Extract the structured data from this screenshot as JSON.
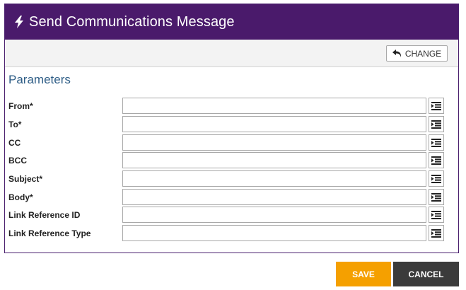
{
  "dialog": {
    "title": "Send Communications Message",
    "title_icon": "lightning-bolt-icon"
  },
  "toolbar": {
    "change_label": "CHANGE",
    "change_icon": "undo-arrow-icon"
  },
  "parameters": {
    "heading": "Parameters",
    "fields": [
      {
        "label": "From*",
        "value": ""
      },
      {
        "label": "To*",
        "value": ""
      },
      {
        "label": "CC",
        "value": ""
      },
      {
        "label": "BCC",
        "value": ""
      },
      {
        "label": "Subject*",
        "value": ""
      },
      {
        "label": "Body*",
        "value": ""
      },
      {
        "label": "Link Reference ID",
        "value": ""
      },
      {
        "label": "Link Reference Type",
        "value": ""
      }
    ],
    "picker_icon": "list-indent-icon"
  },
  "footer": {
    "save_label": "SAVE",
    "cancel_label": "CANCEL"
  },
  "colors": {
    "title_bar": "#4a1a6b",
    "save": "#f5a000",
    "cancel": "#3b3b3b",
    "heading": "#2e5d86"
  }
}
